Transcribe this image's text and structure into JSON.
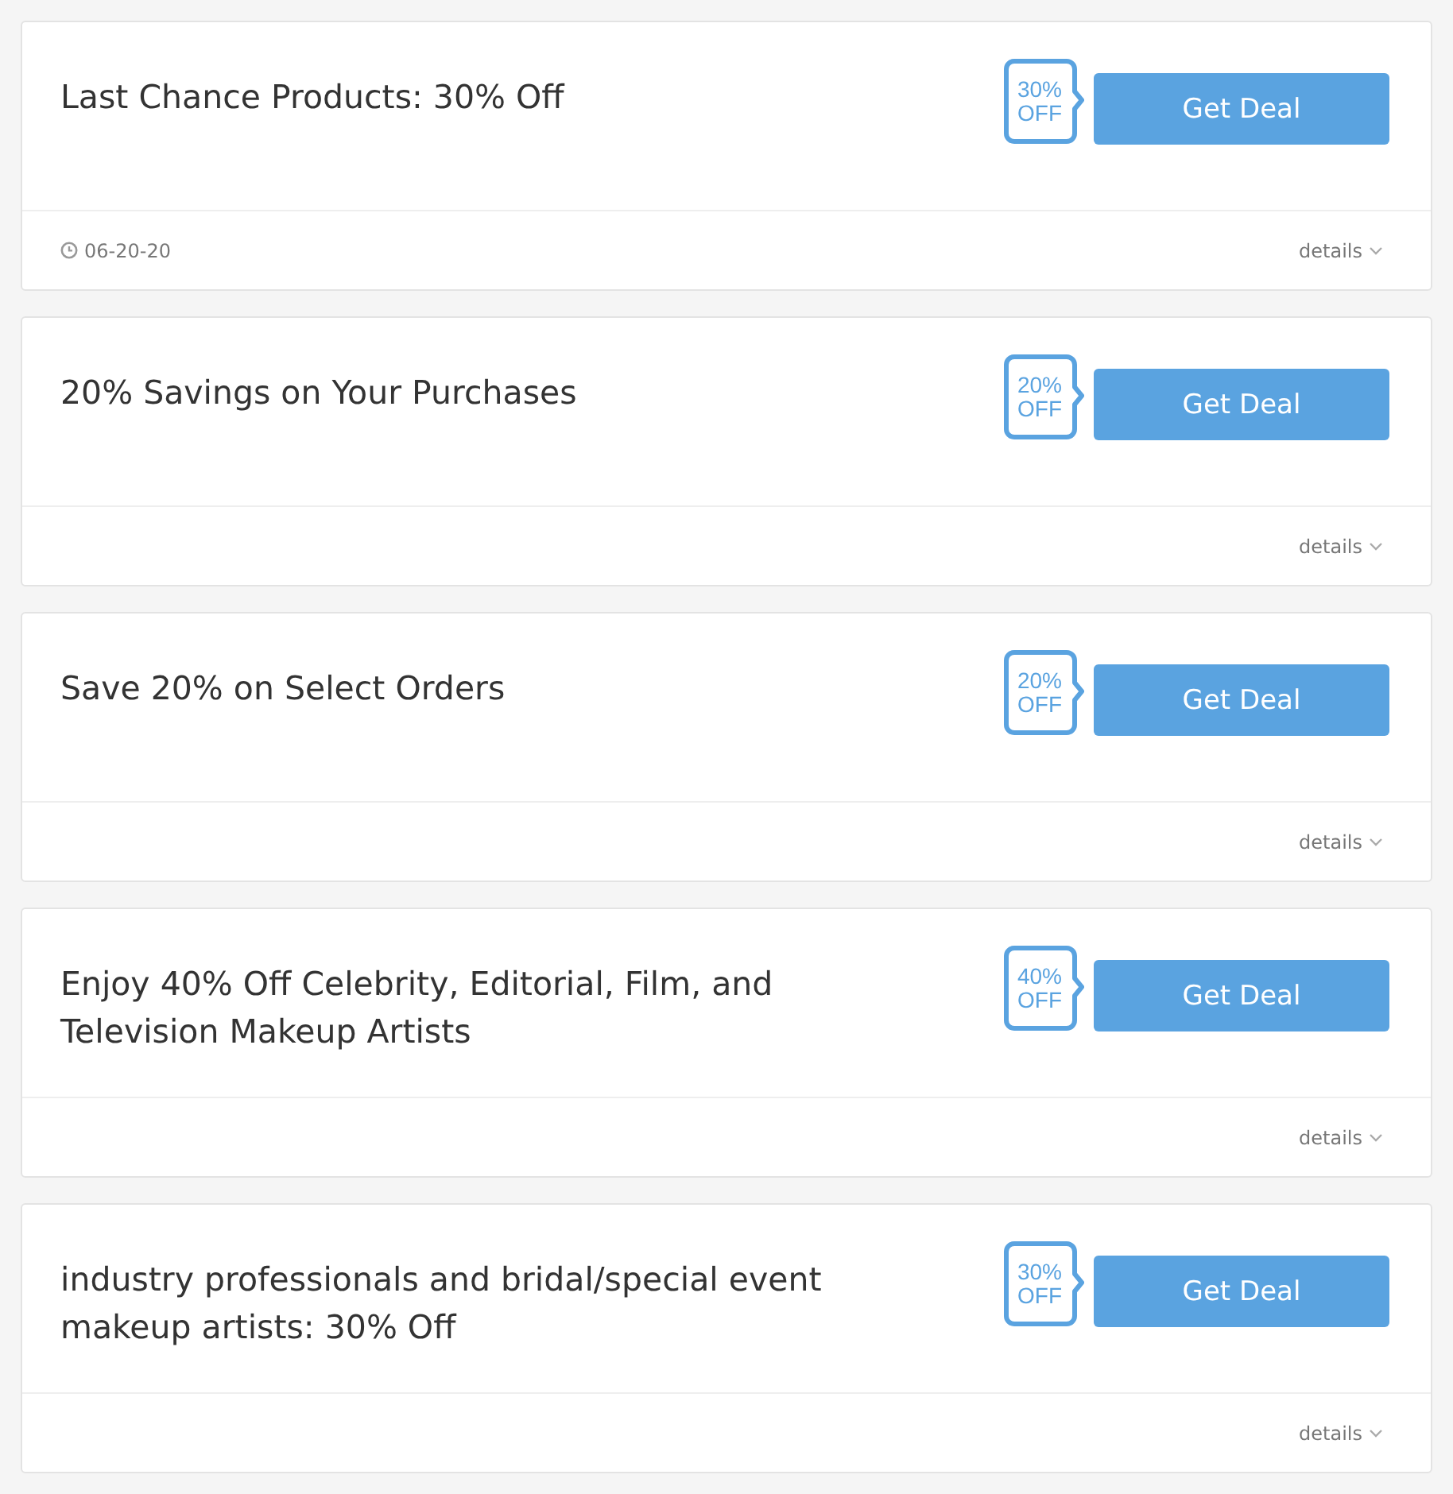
{
  "deals": [
    {
      "title": "Last Chance Products: 30% Off",
      "badge": [
        "30%",
        "OFF"
      ],
      "button": "Get Deal",
      "date": "06-20-20",
      "details": "details"
    },
    {
      "title": "20% Savings on Your Purchases",
      "badge": [
        "20%",
        "OFF"
      ],
      "button": "Get Deal",
      "details": "details"
    },
    {
      "title": "Save 20% on Select Orders",
      "badge": [
        "20%",
        "OFF"
      ],
      "button": "Get Deal",
      "details": "details"
    },
    {
      "title": "Enjoy 40% Off Celebrity, Editorial, Film, and Television Makeup Artists",
      "badge": [
        "40%",
        "OFF"
      ],
      "button": "Get Deal",
      "details": "details"
    },
    {
      "title": "industry professionals and bridal/special event makeup artists: 30% Off",
      "badge": [
        "30%",
        "OFF"
      ],
      "button": "Get Deal",
      "details": "details"
    }
  ]
}
